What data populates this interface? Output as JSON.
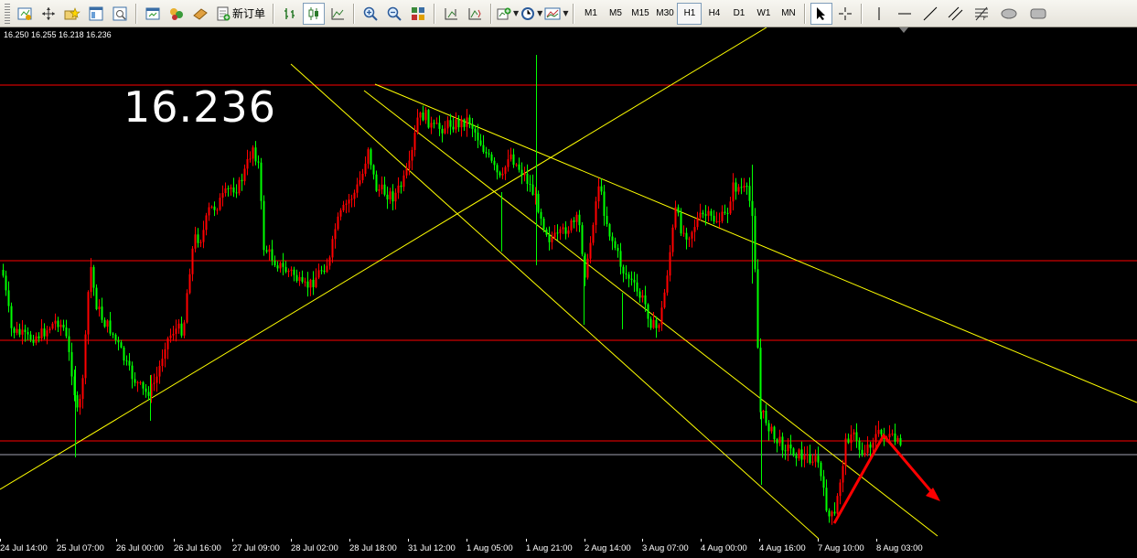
{
  "toolbar": {
    "new_order_label": "新订单",
    "timeframes": [
      "M1",
      "M5",
      "M15",
      "M30",
      "H1",
      "H4",
      "D1",
      "W1",
      "MN"
    ],
    "active_timeframe": "H1",
    "icons": [
      "new-chart-icon",
      "move-icon",
      "favorites-icon",
      "data-window-icon",
      "navigator-icon",
      "terminal-icon",
      "experts-icon",
      "history-icon",
      "new-order-icon",
      "bar-chart-icon",
      "candlestick-icon",
      "line-chart-icon",
      "zoom-in-icon",
      "zoom-out-icon",
      "tile-windows-icon",
      "auto-scroll-icon",
      "chart-shift-icon",
      "indicators-icon",
      "periods-icon",
      "templates-icon",
      "cursor-icon",
      "crosshair-icon",
      "vertical-line-icon",
      "horizontal-line-icon",
      "trendline-icon",
      "equidistant-channel-icon",
      "fibonacci-icon",
      "ellipse-icon",
      "rectangle-icon"
    ]
  },
  "chart": {
    "ohlc_text": "16.250 16.255 16.218 16.236",
    "price_label": "16.236",
    "colors": {
      "background": "#000000",
      "bull_candle": "#ff0000",
      "bear_candle": "#00ff00",
      "trendline": "#ffff00",
      "hline": "#ff0000",
      "arrow": "#ff0000",
      "bid_line": "#a0a0b0"
    },
    "x_ticks": [
      "24 Jul 14:00",
      "25 Jul 07:00",
      "26 Jul 00:00",
      "26 Jul 16:00",
      "27 Jul 09:00",
      "28 Jul 02:00",
      "28 Jul 18:00",
      "31 Jul 12:00",
      "1 Aug 05:00",
      "1 Aug 21:00",
      "2 Aug 14:00",
      "3 Aug 07:00",
      "4 Aug 00:00",
      "4 Aug 16:00",
      "7 Aug 10:00",
      "8 Aug 03:00"
    ]
  }
}
